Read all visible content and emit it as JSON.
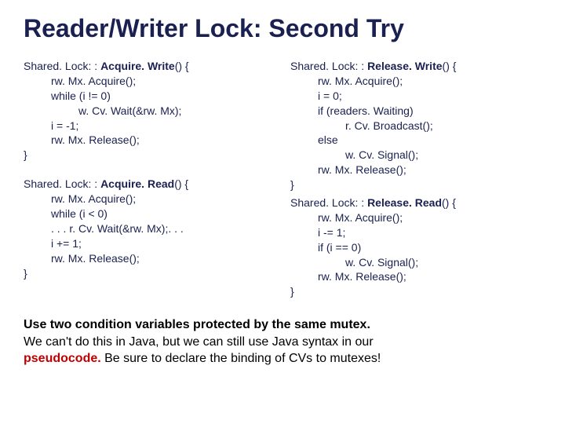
{
  "title": "Reader/Writer Lock: Second Try",
  "left": {
    "aw": {
      "sig": "Shared. Lock: : ",
      "fn": "Acquire. Write",
      "after": "() {",
      "l1": "rw. Mx. Acquire();",
      "l2": "while (i != 0)",
      "l3": "w. Cv. Wait(&rw. Mx);",
      "l4": "i = -1;",
      "l5": "rw. Mx. Release();",
      "close": "}"
    },
    "ar": {
      "sig": "Shared. Lock: : ",
      "fn": "Acquire. Read",
      "after": "() {",
      "l1": "rw. Mx. Acquire();",
      "l2": "while (i < 0)",
      "l3": ". . . r. Cv. Wait(&rw. Mx);. . .",
      "l4": "i += 1;",
      "l5": "rw. Mx. Release();",
      "close": "}"
    }
  },
  "right": {
    "rw": {
      "sig": "Shared. Lock: : ",
      "fn": "Release. Write",
      "after": "() {",
      "l1": "rw. Mx. Acquire();",
      "l2": "i = 0;",
      "l3": "if (readers. Waiting)",
      "l4": "r. Cv. Broadcast();",
      "l5": "else",
      "l6": "w. Cv. Signal();",
      "l7": "rw. Mx. Release();",
      "close": "}"
    },
    "rr": {
      "sig": "Shared. Lock: : ",
      "fn": "Release. Read",
      "after": "() {",
      "l1": "rw. Mx. Acquire();",
      "l2": "i -= 1;",
      "l3": "if (i == 0)",
      "l4": "w. Cv. Signal();",
      "l5": "rw. Mx. Release();",
      "close": "}"
    }
  },
  "bottom": {
    "p1a": "Use two condition variables protected by the same mutex.",
    "p2": "We can't do this in Java, but we can still use Java syntax in our ",
    "p3a": "pseudocode.",
    "p3b": "   Be sure to declare the binding of CVs to mutexes!"
  }
}
